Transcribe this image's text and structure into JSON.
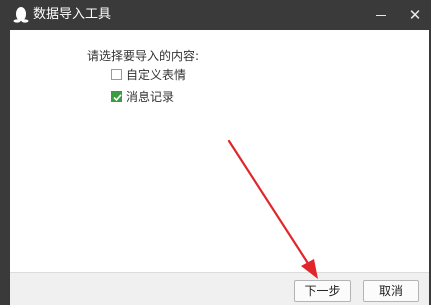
{
  "window": {
    "title": "数据导入工具",
    "app_icon": "penguin-icon",
    "minimize_icon": "minimize-icon",
    "close_icon": "close-icon",
    "close_glyph": "✕"
  },
  "content": {
    "prompt": "请选择要导入的内容:",
    "options": [
      {
        "label": "自定义表情",
        "checked": false
      },
      {
        "label": "消息记录",
        "checked": true
      }
    ]
  },
  "footer": {
    "next_label": "下一步",
    "cancel_label": "取消"
  },
  "colors": {
    "titlebar": "#3a3a3a",
    "checkbox_checked": "#3a9d3f",
    "annotation_arrow": "#e0262a"
  }
}
